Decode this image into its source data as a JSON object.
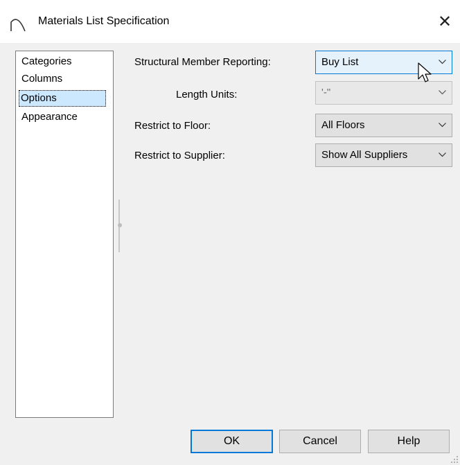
{
  "window": {
    "title": "Materials List Specification",
    "app_icon": "arch-icon",
    "close_glyph": "✕"
  },
  "sidebar": {
    "items": [
      {
        "label": "Categories",
        "selected": false
      },
      {
        "label": "Columns",
        "selected": false
      },
      {
        "label": "Options",
        "selected": true
      },
      {
        "label": "Appearance",
        "selected": false
      }
    ]
  },
  "options": {
    "structural_member_reporting": {
      "label": "Structural Member Reporting:",
      "value": "Buy List"
    },
    "length_units": {
      "label": "Length Units:",
      "value": "'-\"",
      "enabled": false
    },
    "restrict_to_floor": {
      "label": "Restrict to Floor:",
      "value": "All Floors"
    },
    "restrict_to_supplier": {
      "label": "Restrict to Supplier:",
      "value": "Show All Suppliers"
    }
  },
  "buttons": {
    "ok": "OK",
    "cancel": "Cancel",
    "help": "Help"
  },
  "colors": {
    "accent": "#0078d7",
    "selection": "#cce8ff",
    "dialog_bg": "#f0f0f0"
  }
}
